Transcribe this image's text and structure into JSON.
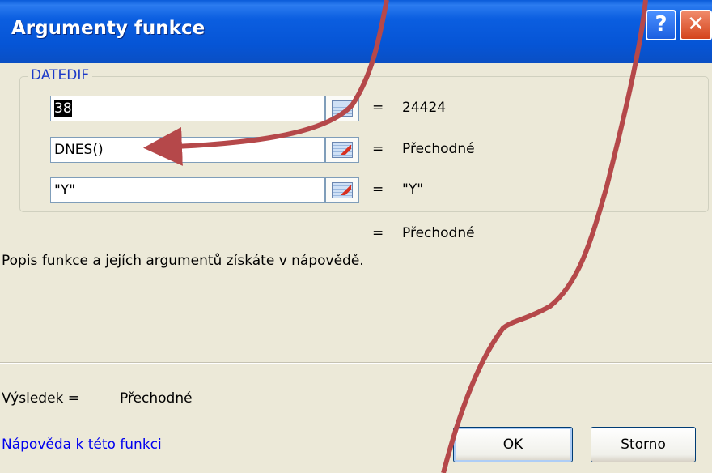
{
  "window": {
    "title": "Argumenty funkce",
    "help_button": "?",
    "close_button": "✕"
  },
  "function": {
    "name": "DATEDIF",
    "arguments": [
      {
        "value": "38",
        "result": "24424",
        "selected": true
      },
      {
        "value": "DNES()",
        "result": "Přechodné"
      },
      {
        "value": "\"Y\"",
        "result": "\"Y\""
      }
    ],
    "equals": "=",
    "formula_result": "Přechodné"
  },
  "description": "Popis funkce a jejích argumentů získáte v nápovědě.",
  "result": {
    "label": "Výsledek =",
    "value": "Přechodné"
  },
  "help_link": "Nápověda k této funkci",
  "buttons": {
    "ok": "OK",
    "cancel": "Storno"
  },
  "annotation": {
    "color": "#b5484a"
  }
}
